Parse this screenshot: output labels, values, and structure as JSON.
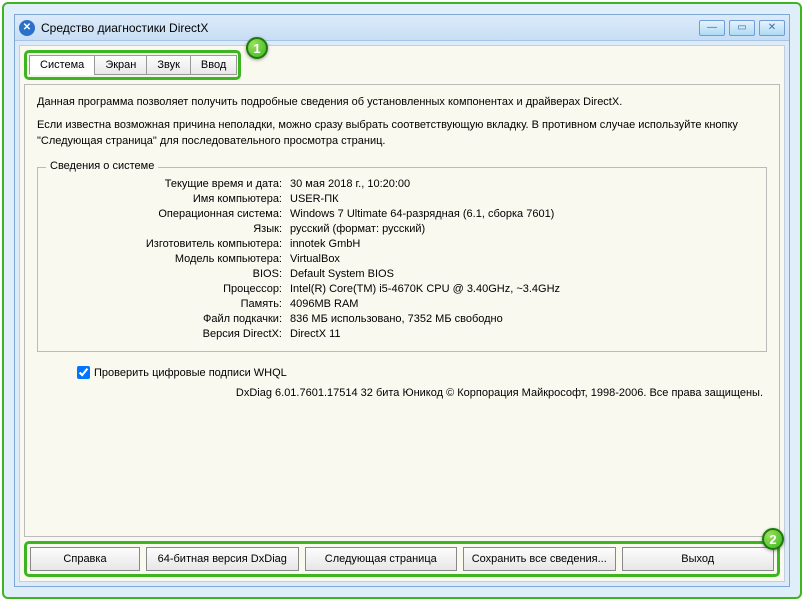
{
  "window": {
    "title": "Средство диагностики DirectX"
  },
  "tabs": {
    "system": "Система",
    "display": "Экран",
    "sound": "Звук",
    "input": "Ввод"
  },
  "intro": {
    "line1": "Данная программа позволяет получить подробные сведения об установленных компонентах и драйверах DirectX.",
    "line2": "Если известна возможная причина неполадки, можно сразу выбрать соответствующую вкладку. В противном случае используйте кнопку \"Следующая страница\" для последовательного просмотра страниц."
  },
  "groupbox": {
    "legend": "Сведения о системе"
  },
  "info": {
    "datetime_label": "Текущие время и дата:",
    "datetime_value": "30 мая 2018 г., 10:20:00",
    "computer_label": "Имя компьютера:",
    "computer_value": "USER-ПК",
    "os_label": "Операционная система:",
    "os_value": "Windows 7 Ultimate 64-разрядная (6.1, сборка 7601)",
    "lang_label": "Язык:",
    "lang_value": "русский (формат: русский)",
    "manufacturer_label": "Изготовитель компьютера:",
    "manufacturer_value": "innotek GmbH",
    "model_label": "Модель компьютера:",
    "model_value": "VirtualBox",
    "bios_label": "BIOS:",
    "bios_value": "Default System BIOS",
    "cpu_label": "Процессор:",
    "cpu_value": "Intel(R) Core(TM) i5-4670K CPU @ 3.40GHz, ~3.4GHz",
    "memory_label": "Память:",
    "memory_value": "4096MB RAM",
    "pagefile_label": "Файл подкачки:",
    "pagefile_value": "836 МБ использовано, 7352 МБ свободно",
    "dx_label": "Версия DirectX:",
    "dx_value": "DirectX 11"
  },
  "checkbox": {
    "label": "Проверить цифровые подписи WHQL"
  },
  "footer": "DxDiag 6.01.7601.17514 32 бита Юникод   © Корпорация Майкрософт, 1998-2006.  Все права защищены.",
  "buttons": {
    "help": "Справка",
    "bit64": "64-битная версия DxDiag",
    "next": "Следующая страница",
    "save": "Сохранить все сведения...",
    "exit": "Выход"
  },
  "annotations": {
    "a1": "1",
    "a2": "2"
  }
}
